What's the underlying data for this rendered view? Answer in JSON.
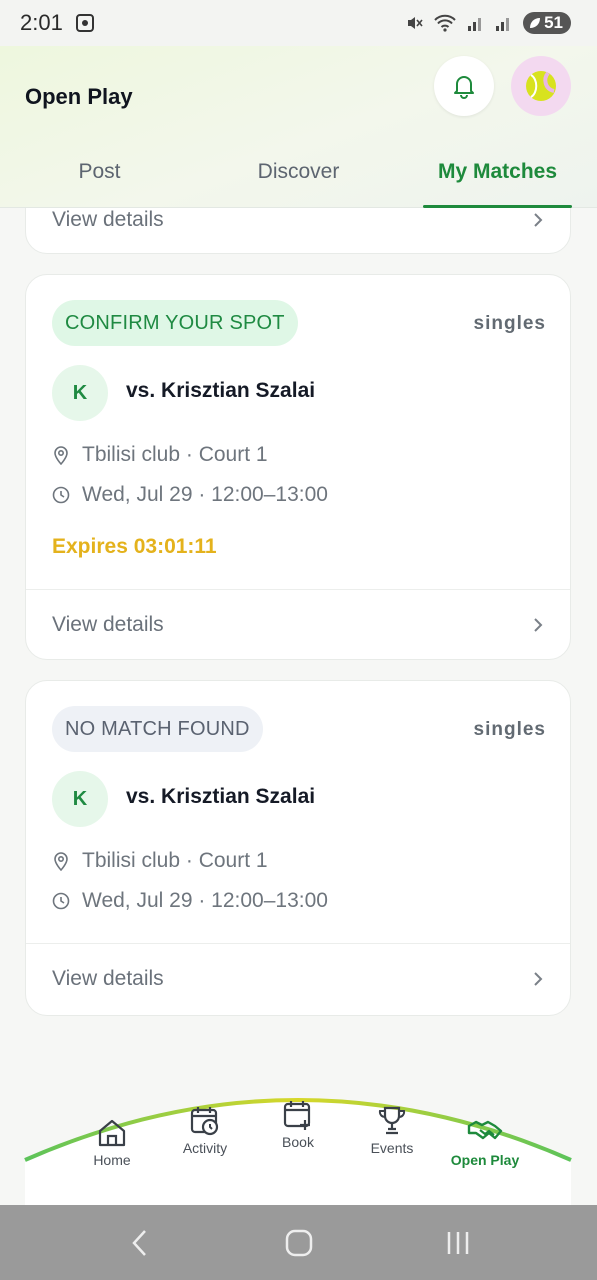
{
  "status_bar": {
    "time": "2:01",
    "battery": "51"
  },
  "header": {
    "title": "Open Play"
  },
  "tabs": [
    {
      "label": "Post"
    },
    {
      "label": "Discover"
    },
    {
      "label": "My Matches"
    }
  ],
  "partial_card": {
    "view_details": "View details"
  },
  "matches": [
    {
      "badge": "CONFIRM YOUR SPOT",
      "type": "singles",
      "opponent_initial": "K",
      "opponent": "vs. Krisztian Szalai",
      "location": "Tbilisi club · Court 1",
      "datetime": "Wed, Jul 29 · 12:00–13:00",
      "expires": "Expires 03:01:11",
      "view_details": "View details"
    },
    {
      "badge": "NO MATCH FOUND",
      "type": "singles",
      "opponent_initial": "K",
      "opponent": "vs. Krisztian Szalai",
      "location": "Tbilisi club · Court 1",
      "datetime": "Wed, Jul 29 · 12:00–13:00",
      "view_details": "View details"
    }
  ],
  "bottom_nav": [
    {
      "label": "Home",
      "icon": "home-icon"
    },
    {
      "label": "Activity",
      "icon": "calendar-clock-icon"
    },
    {
      "label": "Book",
      "icon": "calendar-plus-icon"
    },
    {
      "label": "Events",
      "icon": "trophy-icon"
    },
    {
      "label": "Open Play",
      "icon": "handshake-icon"
    }
  ],
  "colors": {
    "accent": "#1e8a3c",
    "expires": "#e4b21c",
    "badge_green_bg": "#dff7e6",
    "badge_gray_bg": "#eef1f6"
  }
}
